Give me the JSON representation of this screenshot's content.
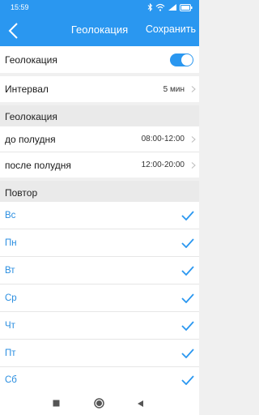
{
  "status": {
    "time": "15:59",
    "icons": [
      "bluetooth-icon",
      "wifi-icon",
      "signal-icon",
      "battery-icon"
    ]
  },
  "header": {
    "title": "Геолокация",
    "save_label": "Сохранить",
    "back_icon": "chevron-left-icon"
  },
  "geolocation_toggle": {
    "label": "Геолокация",
    "enabled": true
  },
  "interval": {
    "label": "Интервал",
    "value": "5 мин"
  },
  "geolocation_section": {
    "title": "Геолокация",
    "items": [
      {
        "label": "до полудня",
        "value": "08:00-12:00"
      },
      {
        "label": "после полудня",
        "value": "12:00-20:00"
      }
    ]
  },
  "repeat_section": {
    "title": "Повтор",
    "days": [
      {
        "label": "Вс",
        "checked": true
      },
      {
        "label": "Пн",
        "checked": true
      },
      {
        "label": "Вт",
        "checked": true
      },
      {
        "label": "Ср",
        "checked": true
      },
      {
        "label": "Чт",
        "checked": true
      },
      {
        "label": "Пт",
        "checked": true
      },
      {
        "label": "Сб",
        "checked": true
      }
    ]
  },
  "colors": {
    "accent": "#2a97f0",
    "day_text": "#2a8ee0",
    "section_bg": "#eaeaea"
  },
  "system_nav": [
    "square-icon",
    "circle-icon",
    "triangle-back-icon"
  ]
}
